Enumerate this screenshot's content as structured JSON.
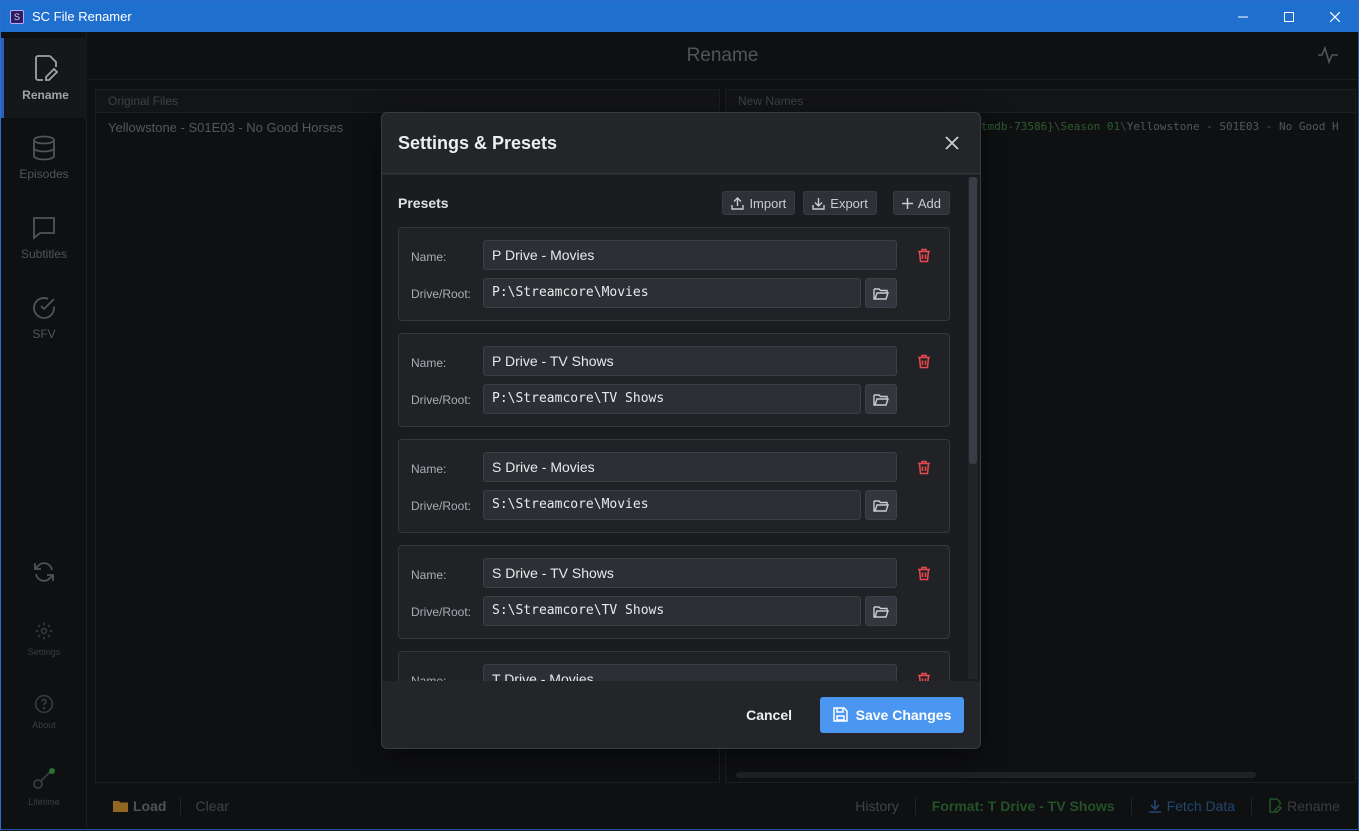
{
  "window": {
    "title": "SC File Renamer"
  },
  "sidebar": {
    "items": [
      {
        "label": "Rename",
        "icon": "edit-file-icon",
        "active": true
      },
      {
        "label": "Episodes",
        "icon": "database-icon"
      },
      {
        "label": "Subtitles",
        "icon": "chat-bubble-icon"
      },
      {
        "label": "SFV",
        "icon": "check-circle-icon"
      }
    ],
    "bottom": [
      {
        "label": "",
        "icon": "refresh-icon"
      },
      {
        "label": "Settings",
        "icon": "gear-icon"
      },
      {
        "label": "About",
        "icon": "help-circle-icon"
      },
      {
        "label": "Lifetime",
        "icon": "key-icon"
      }
    ]
  },
  "main": {
    "header_title": "Rename",
    "original_panel": {
      "title": "Original Files",
      "files": [
        "Yellowstone - S01E03 - No Good Horses"
      ]
    },
    "new_panel": {
      "title": "New Names",
      "names": [
        {
          "green": "tmdb-73586}",
          "sep1": "\\",
          "season": "Season 01",
          "sep2": "\\",
          "rest": "Yellowstone - S01E03 - No Good H"
        }
      ]
    },
    "bottom_left": {
      "load": "Load",
      "clear": "Clear"
    },
    "bottom_right": {
      "history": "History",
      "format": "Format: T Drive - TV Shows",
      "fetch": "Fetch Data",
      "rename": "Rename"
    }
  },
  "modal": {
    "title": "Settings & Presets",
    "presets_label": "Presets",
    "buttons": {
      "import": "Import",
      "export": "Export",
      "add": "Add"
    },
    "name_label": "Name:",
    "root_label": "Drive/Root:",
    "presets": [
      {
        "name": "P Drive - Movies",
        "root": "P:\\Streamcore\\Movies"
      },
      {
        "name": "P Drive - TV Shows",
        "root": "P:\\Streamcore\\TV Shows"
      },
      {
        "name": "S Drive - Movies",
        "root": "S:\\Streamcore\\Movies"
      },
      {
        "name": "S Drive - TV Shows",
        "root": "S:\\Streamcore\\TV Shows"
      },
      {
        "name": "T Drive - Movies",
        "root": ""
      }
    ],
    "cancel": "Cancel",
    "save": "Save Changes"
  },
  "colors": {
    "accent": "#4a96f0",
    "danger": "#e5484d",
    "success": "#3a9a44"
  }
}
